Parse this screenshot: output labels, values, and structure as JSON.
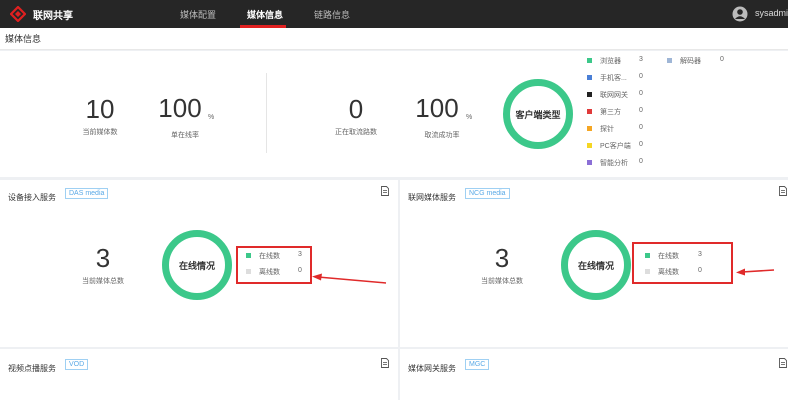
{
  "header": {
    "brand": "联网共享",
    "tabs": [
      "媒体配置",
      "媒体信息",
      "链路信息"
    ],
    "active_tab": "媒体信息",
    "user": "sysadmin"
  },
  "page_title": "媒体信息",
  "summary": {
    "current_media_count": "10",
    "current_media_label": "当前媒体数",
    "online_rate": "100",
    "online_rate_unit": "%",
    "online_rate_label": "单在线率",
    "pulling_count": "0",
    "pulling_label": "正在取流路数",
    "pull_success_rate": "100",
    "pull_success_unit": "%",
    "pull_success_label": "取流成功率",
    "client_type_label": "客户端类型",
    "client_types": [
      {
        "label": "浏览器",
        "value": "3",
        "color": "#3cc88a"
      },
      {
        "label": "手机客...",
        "value": "0",
        "color": "#4a7fd6"
      },
      {
        "label": "联网网关",
        "value": "0",
        "color": "#222222"
      },
      {
        "label": "第三方",
        "value": "0",
        "color": "#e03a3a"
      },
      {
        "label": "探针",
        "value": "0",
        "color": "#f5a623"
      },
      {
        "label": "PC客户端",
        "value": "0",
        "color": "#f5d623"
      },
      {
        "label": "智能分析",
        "value": "0",
        "color": "#8b6fd6"
      }
    ],
    "decoder": {
      "label": "解码器",
      "value": "0",
      "color": "#9fb6d6"
    }
  },
  "cards": [
    {
      "title": "设备接入服务",
      "tag": "DAS media",
      "total": "3",
      "total_label": "当前媒体总数",
      "ring_label": "在线情况",
      "online_label": "在线数",
      "online_value": "3",
      "offline_label": "离线数",
      "offline_value": "0"
    },
    {
      "title": "联网媒体服务",
      "tag": "NCG media",
      "total": "3",
      "total_label": "当前媒体总数",
      "ring_label": "在线情况",
      "online_label": "在线数",
      "online_value": "3",
      "offline_label": "离线数",
      "offline_value": "0"
    },
    {
      "title": "视频点播服务",
      "tag": "VOD"
    },
    {
      "title": "媒体网关服务",
      "tag": "MGC"
    }
  ],
  "colors": {
    "ring": "#3cc88a",
    "online": "#3cc88a",
    "offline": "#dddddd",
    "annotation": "#e02a2a",
    "tag": "#5aa9e6"
  }
}
